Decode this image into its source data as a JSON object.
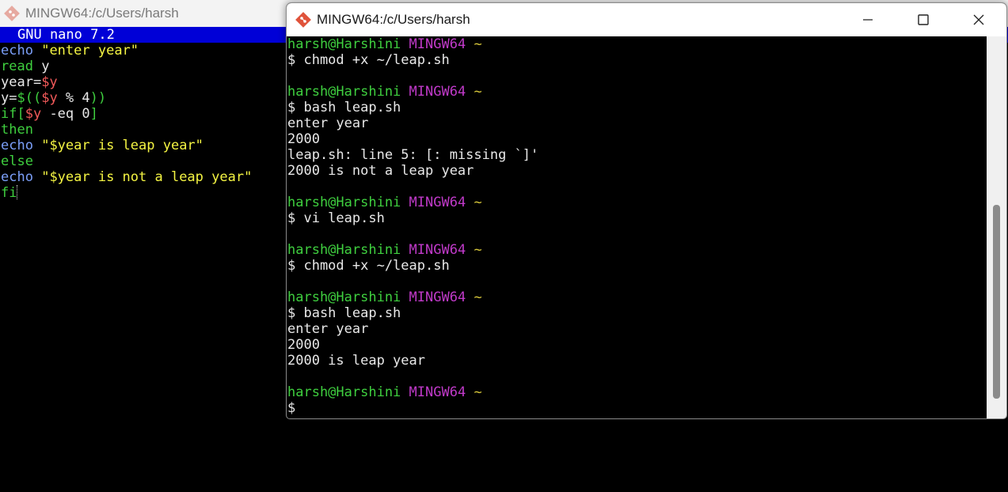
{
  "back_window": {
    "title": "MINGW64:/c/Users/harsh",
    "nano_header": "GNU nano 7.2",
    "code_lines": [
      [
        {
          "t": "echo",
          "c": "kw-blue"
        },
        {
          "t": " ",
          "c": "plain"
        },
        {
          "t": "\"enter year\"",
          "c": "str"
        }
      ],
      [
        {
          "t": "read",
          "c": "kw-green"
        },
        {
          "t": " y",
          "c": "plain"
        }
      ],
      [
        {
          "t": "year=",
          "c": "plain"
        },
        {
          "t": "$y",
          "c": "var"
        }
      ],
      [
        {
          "t": "y=",
          "c": "plain"
        },
        {
          "t": "$((",
          "c": "kw-green"
        },
        {
          "t": "$y",
          "c": "var"
        },
        {
          "t": " % 4",
          "c": "plain"
        },
        {
          "t": "))",
          "c": "kw-green"
        }
      ],
      [
        {
          "t": "if[",
          "c": "kw-green"
        },
        {
          "t": "$y",
          "c": "var"
        },
        {
          "t": " -eq 0",
          "c": "plain"
        },
        {
          "t": "]",
          "c": "kw-green"
        }
      ],
      [
        {
          "t": "then",
          "c": "kw-green"
        }
      ],
      [
        {
          "t": "echo",
          "c": "kw-blue"
        },
        {
          "t": " ",
          "c": "plain"
        },
        {
          "t": "\"$year is leap year\"",
          "c": "str"
        }
      ],
      [
        {
          "t": "else",
          "c": "kw-green"
        }
      ],
      [
        {
          "t": "echo",
          "c": "kw-blue"
        },
        {
          "t": " ",
          "c": "plain"
        },
        {
          "t": "\"$year is not a leap year\"",
          "c": "str"
        }
      ],
      [
        {
          "t": "fi",
          "c": "kw-green"
        }
      ]
    ]
  },
  "front_window": {
    "title": "MINGW64:/c/Users/harsh",
    "controls": {
      "minimize": "minimize-icon",
      "maximize": "maximize-icon",
      "close": "close-icon"
    },
    "prompt": {
      "user": "harsh@Harshini",
      "host": "MINGW64",
      "dir": "~"
    },
    "lines": [
      {
        "type": "prompt"
      },
      {
        "type": "cmd",
        "text": "$ chmod +x ~/leap.sh"
      },
      {
        "type": "blank"
      },
      {
        "type": "prompt"
      },
      {
        "type": "cmd",
        "text": "$ bash leap.sh"
      },
      {
        "type": "out",
        "text": "enter year"
      },
      {
        "type": "out",
        "text": "2000"
      },
      {
        "type": "out",
        "text": "leap.sh: line 5: [: missing `]'"
      },
      {
        "type": "out",
        "text": "2000 is not a leap year"
      },
      {
        "type": "blank"
      },
      {
        "type": "prompt"
      },
      {
        "type": "cmd",
        "text": "$ vi leap.sh"
      },
      {
        "type": "blank"
      },
      {
        "type": "prompt"
      },
      {
        "type": "cmd",
        "text": "$ chmod +x ~/leap.sh"
      },
      {
        "type": "blank"
      },
      {
        "type": "prompt"
      },
      {
        "type": "cmd",
        "text": "$ bash leap.sh"
      },
      {
        "type": "out",
        "text": "enter year"
      },
      {
        "type": "out",
        "text": "2000"
      },
      {
        "type": "out",
        "text": "2000 is leap year"
      },
      {
        "type": "blank"
      },
      {
        "type": "prompt"
      },
      {
        "type": "cmd",
        "text": "$"
      }
    ]
  },
  "colors": {
    "user": "#3fcf3f",
    "host": "#c03ac9",
    "tilde": "#d7c73a",
    "nano_header_bg": "#0000d7"
  }
}
